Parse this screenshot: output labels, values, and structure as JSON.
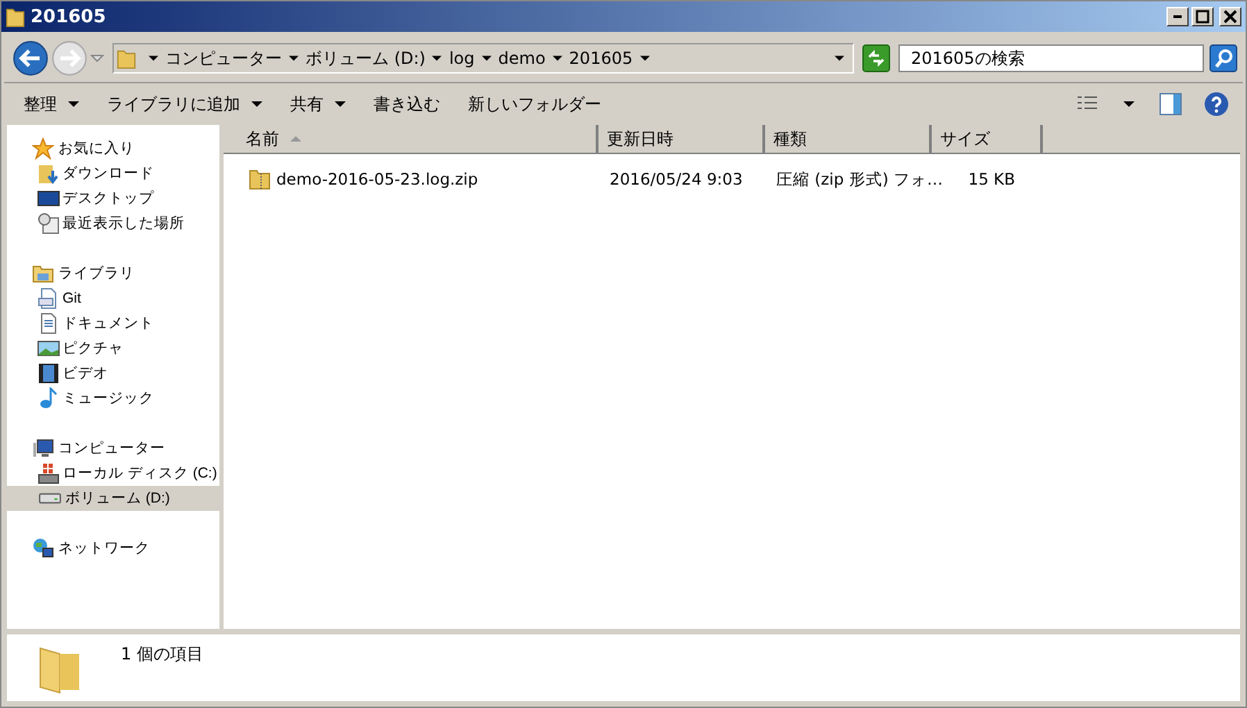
{
  "window": {
    "title": "201605"
  },
  "address": {
    "crumbs": [
      "コンピューター",
      "ボリューム (D:)",
      "log",
      "demo",
      "201605"
    ]
  },
  "search": {
    "placeholder": "201605の検索"
  },
  "toolbar": {
    "items": [
      {
        "label": "整理",
        "has_menu": true
      },
      {
        "label": "ライブラリに追加",
        "has_menu": true
      },
      {
        "label": "共有",
        "has_menu": true
      },
      {
        "label": "書き込む",
        "has_menu": false
      },
      {
        "label": "新しいフォルダー",
        "has_menu": false
      }
    ]
  },
  "sidebar": {
    "groups": [
      {
        "label": "お気に入り",
        "kind": "favorites",
        "children": [
          {
            "label": "ダウンロード",
            "kind": "downloads",
            "selected": false
          },
          {
            "label": "デスクトップ",
            "kind": "desktop",
            "selected": false
          },
          {
            "label": "最近表示した場所",
            "kind": "recent",
            "selected": false
          }
        ]
      },
      {
        "label": "ライブラリ",
        "kind": "libraries",
        "children": [
          {
            "label": "Git",
            "kind": "git",
            "selected": false
          },
          {
            "label": "ドキュメント",
            "kind": "documents",
            "selected": false
          },
          {
            "label": "ピクチャ",
            "kind": "pictures",
            "selected": false
          },
          {
            "label": "ビデオ",
            "kind": "videos",
            "selected": false
          },
          {
            "label": "ミュージック",
            "kind": "music",
            "selected": false
          }
        ]
      },
      {
        "label": "コンピューター",
        "kind": "computer",
        "children": [
          {
            "label": "ローカル ディスク (C:)",
            "kind": "drive",
            "selected": false
          },
          {
            "label": "ボリューム (D:)",
            "kind": "volume",
            "selected": true
          }
        ]
      },
      {
        "label": "ネットワーク",
        "kind": "network"
      }
    ]
  },
  "table": {
    "columns": [
      {
        "label": "名前",
        "sorted": true
      },
      {
        "label": "更新日時",
        "sorted": false
      },
      {
        "label": "種類",
        "sorted": false
      },
      {
        "label": "サイズ",
        "sorted": false
      }
    ],
    "rows": [
      {
        "name": "demo-2016-05-23.log.zip",
        "modified": "2016/05/24 9:03",
        "type": "圧縮 (zip 形式) フォ…",
        "size": "15 KB"
      }
    ]
  },
  "status_bar": {
    "text": "1 個の項目"
  }
}
